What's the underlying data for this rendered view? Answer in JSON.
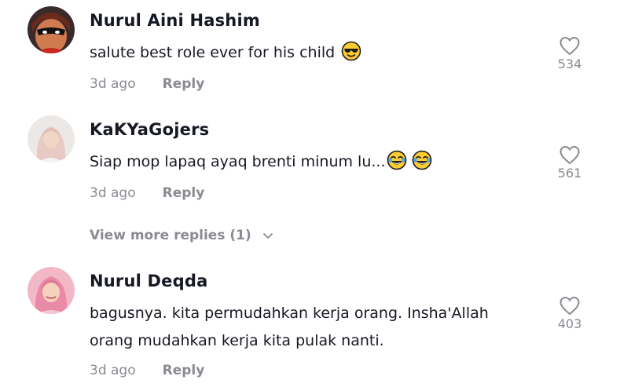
{
  "comments": [
    {
      "username": "Nurul Aini Hashim",
      "text": "salute best role ever for his child",
      "time": "3d ago",
      "reply": "Reply",
      "likes": "534",
      "emoji": [
        "cool-face"
      ]
    },
    {
      "username": "KaKYaGojers",
      "text": "Siap mop lapaq ayaq brenti minum lu...",
      "time": "3d ago",
      "reply": "Reply",
      "likes": "561",
      "emoji": [
        "tears-of-joy",
        "tears-of-joy"
      ]
    },
    {
      "username": "Nurul Deqda",
      "text_line1": "bagusnya. kita permudahkan kerja orang. Insha'Allah",
      "text_line2": "orang mudahkan kerja kita pulak nanti.",
      "time": "3d ago",
      "reply": "Reply",
      "likes": "403"
    }
  ],
  "more_replies": "View more replies (1)",
  "colors": {
    "text": "#161823",
    "muted": "#8a8b91",
    "emoji": "#ffcc33"
  }
}
